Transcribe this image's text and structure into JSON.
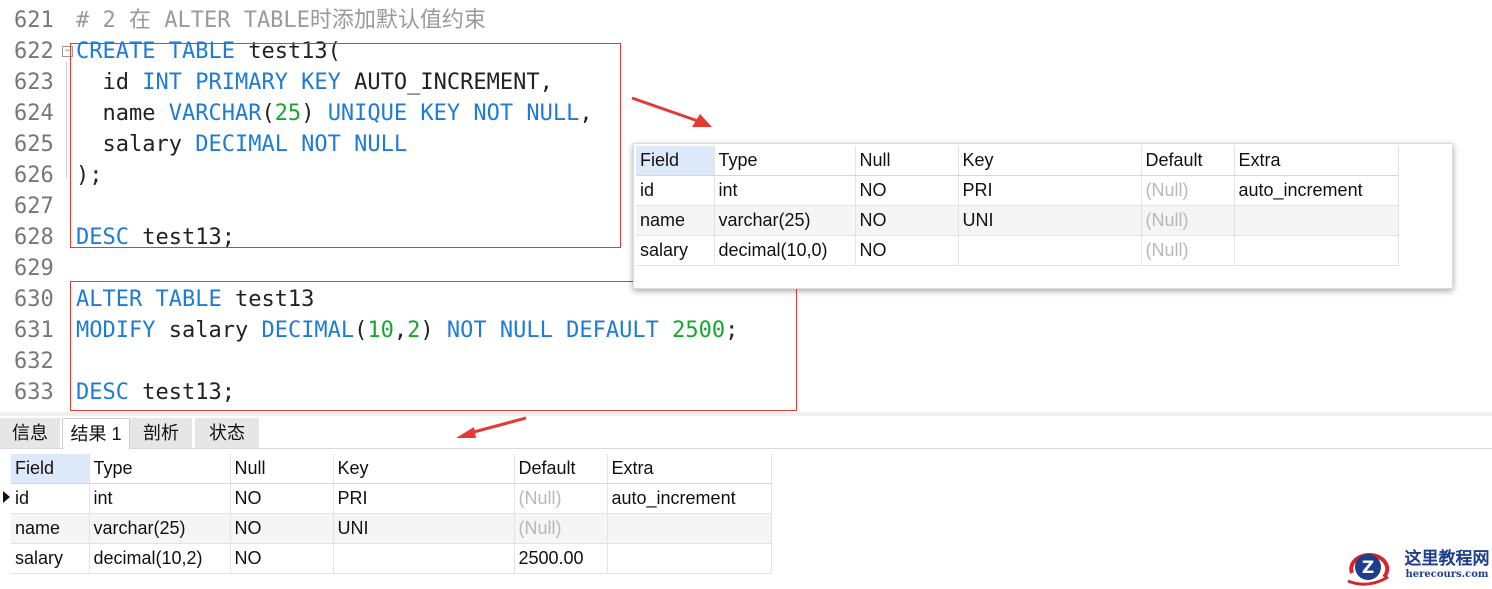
{
  "editor": {
    "lines": [
      {
        "no": "621",
        "tokens": [
          {
            "t": "# 2 在 ALTER TABLE时添加默认值约束",
            "c": "cm"
          }
        ]
      },
      {
        "no": "622",
        "fold": true,
        "tokens": [
          {
            "t": "CREATE TABLE",
            "c": "kw"
          },
          {
            "t": " test13(",
            "c": "pl"
          }
        ]
      },
      {
        "no": "623",
        "tokens": [
          {
            "t": "  id ",
            "c": "pl"
          },
          {
            "t": "INT PRIMARY KEY",
            "c": "kw"
          },
          {
            "t": " AUTO_INCREMENT,",
            "c": "pl"
          }
        ]
      },
      {
        "no": "624",
        "tokens": [
          {
            "t": "  name ",
            "c": "pl"
          },
          {
            "t": "VARCHAR",
            "c": "kw"
          },
          {
            "t": "(",
            "c": "pl"
          },
          {
            "t": "25",
            "c": "num"
          },
          {
            "t": ") ",
            "c": "pl"
          },
          {
            "t": "UNIQUE KEY NOT NULL",
            "c": "kw"
          },
          {
            "t": ",",
            "c": "pl"
          }
        ]
      },
      {
        "no": "625",
        "tokens": [
          {
            "t": "  salary ",
            "c": "pl"
          },
          {
            "t": "DECIMAL NOT NULL",
            "c": "kw"
          }
        ]
      },
      {
        "no": "626",
        "tokens": [
          {
            "t": ");",
            "c": "pl"
          }
        ]
      },
      {
        "no": "627",
        "tokens": []
      },
      {
        "no": "628",
        "tokens": [
          {
            "t": "DESC",
            "c": "kw"
          },
          {
            "t": " test13;",
            "c": "pl"
          }
        ]
      },
      {
        "no": "629",
        "tokens": []
      },
      {
        "no": "630",
        "tokens": [
          {
            "t": "ALTER TABLE",
            "c": "kw"
          },
          {
            "t": " test13",
            "c": "pl"
          }
        ]
      },
      {
        "no": "631",
        "tokens": [
          {
            "t": "MODIFY",
            "c": "kw"
          },
          {
            "t": " salary ",
            "c": "pl"
          },
          {
            "t": "DECIMAL",
            "c": "kw"
          },
          {
            "t": "(",
            "c": "pl"
          },
          {
            "t": "10",
            "c": "num"
          },
          {
            "t": ",",
            "c": "pl"
          },
          {
            "t": "2",
            "c": "num"
          },
          {
            "t": ") ",
            "c": "pl"
          },
          {
            "t": "NOT NULL DEFAULT",
            "c": "kw"
          },
          {
            "t": " ",
            "c": "pl"
          },
          {
            "t": "2500",
            "c": "num"
          },
          {
            "t": ";",
            "c": "pl"
          }
        ]
      },
      {
        "no": "632",
        "tokens": []
      },
      {
        "no": "633",
        "tokens": [
          {
            "t": "DESC",
            "c": "kw"
          },
          {
            "t": " test13;",
            "c": "pl"
          }
        ]
      }
    ]
  },
  "overlay_table": {
    "columns": [
      "Field",
      "Type",
      "Null",
      "Key",
      "Default",
      "Extra"
    ],
    "rows": [
      [
        "id",
        "int",
        "NO",
        "PRI",
        "(Null)",
        "auto_increment"
      ],
      [
        "name",
        "varchar(25)",
        "NO",
        "UNI",
        "(Null)",
        ""
      ],
      [
        "salary",
        "decimal(10,0)",
        "NO",
        "",
        "(Null)",
        ""
      ]
    ]
  },
  "tabs": [
    {
      "label": "信息",
      "active": false
    },
    {
      "label": "结果 1",
      "active": true
    },
    {
      "label": "剖析",
      "active": false
    },
    {
      "label": "状态",
      "active": false
    }
  ],
  "result_table": {
    "columns": [
      "Field",
      "Type",
      "Null",
      "Key",
      "Default",
      "Extra"
    ],
    "rows": [
      [
        "id",
        "int",
        "NO",
        "PRI",
        "(Null)",
        "auto_increment"
      ],
      [
        "name",
        "varchar(25)",
        "NO",
        "UNI",
        "(Null)",
        ""
      ],
      [
        "salary",
        "decimal(10,2)",
        "NO",
        "",
        "2500.00",
        ""
      ]
    ]
  },
  "watermark": {
    "title": "这里教程网",
    "url": "herecours.com",
    "logo_letter": "Z",
    "icon": "logo-icon"
  },
  "colors": {
    "keyword": "#1f7bd6",
    "number": "#17a631",
    "comment": "#9a9a9a",
    "highlight_box": "#e53935",
    "header_cell": "#dde9f8",
    "null_text": "#b8b8b8"
  }
}
